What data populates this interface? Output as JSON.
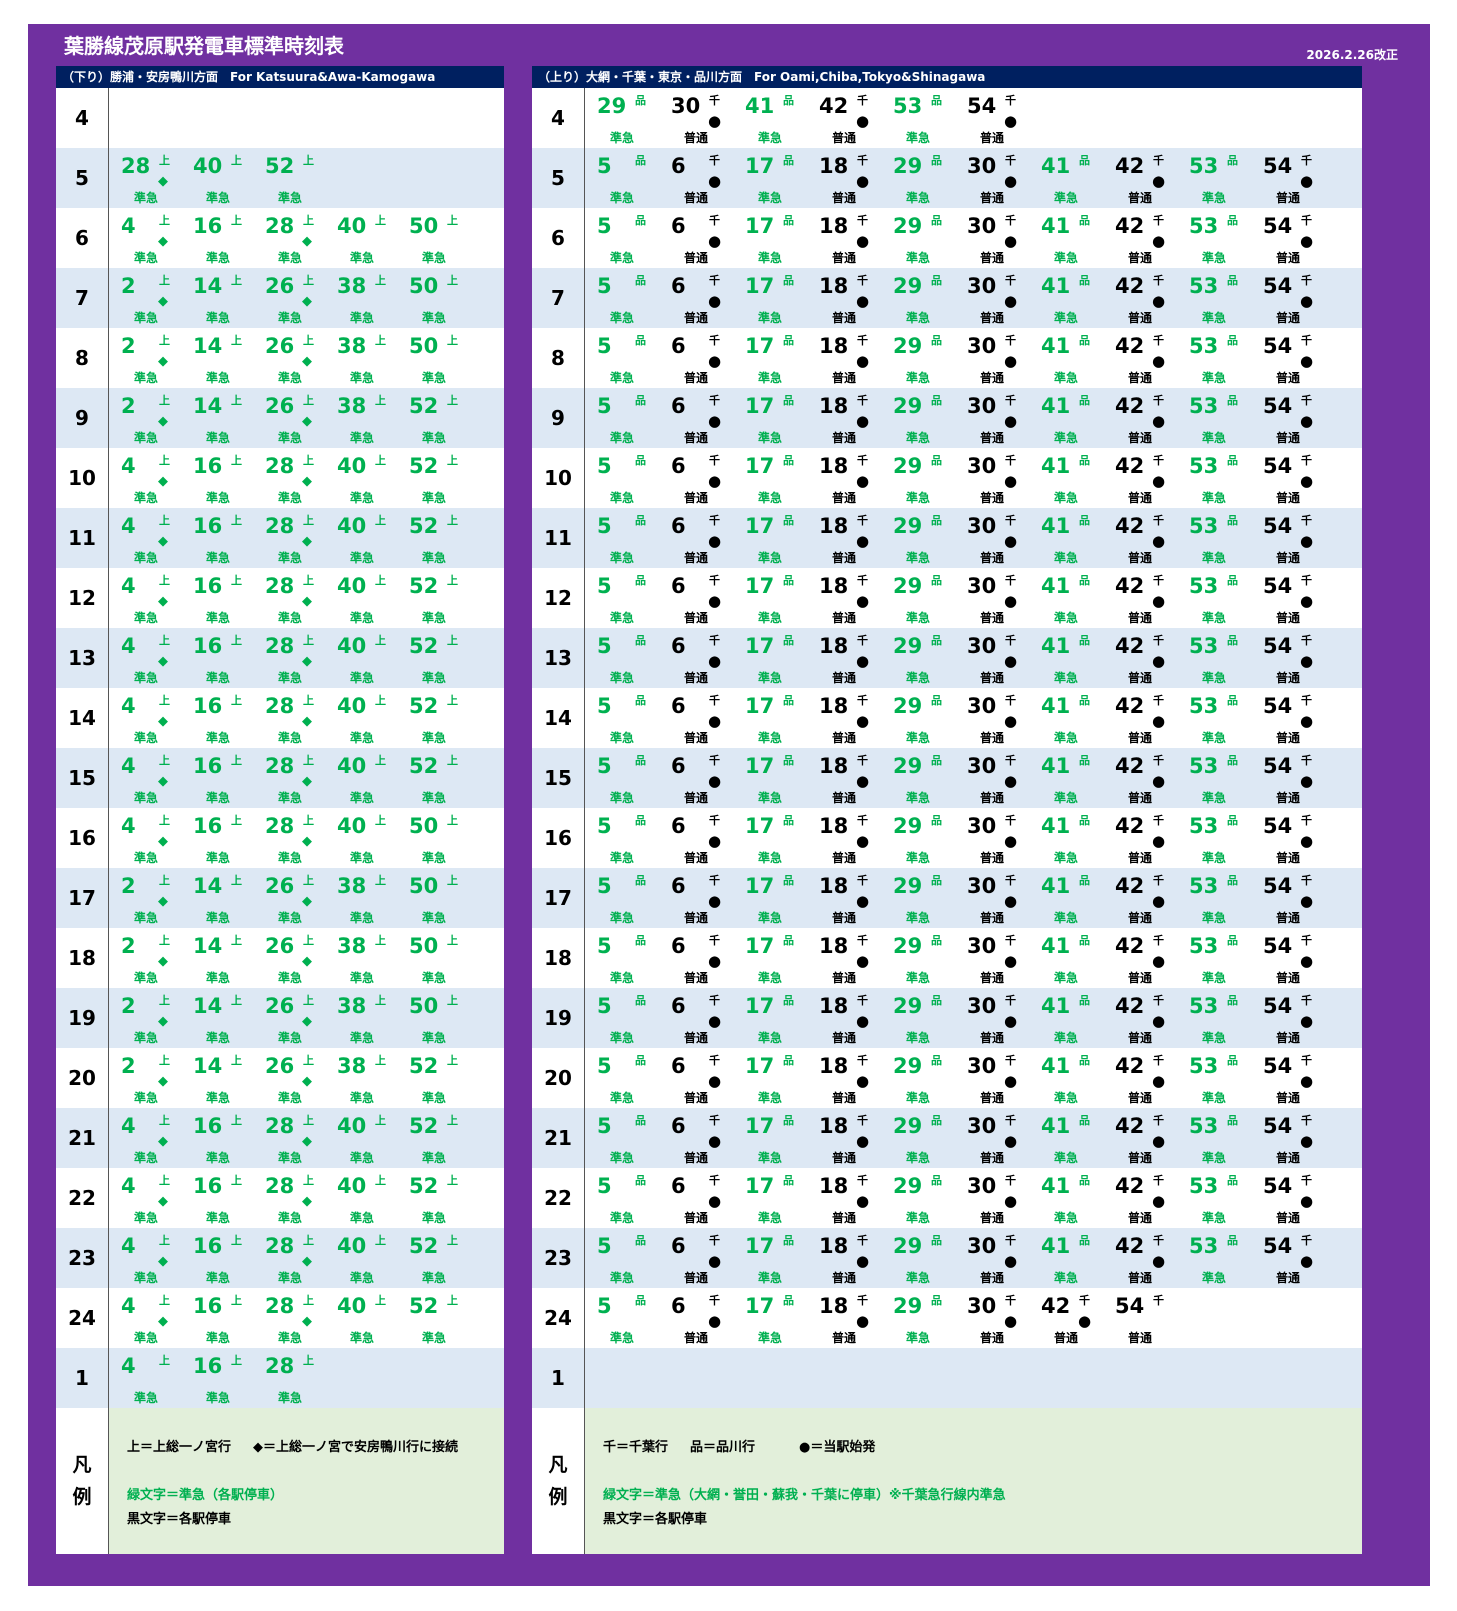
{
  "title": "葉勝線茂原駅発電車標準時刻表",
  "revision": "2026.2.26改正",
  "kind_labels": {
    "g": "準急",
    "b": "普通"
  },
  "dest_labels": {
    "上": "上",
    "品": "品",
    "千": "千"
  },
  "mark_labels": {
    "dm": "◆",
    "cr": "●"
  },
  "down": {
    "header": "（下り）勝浦・安房鴨川方面　For Katsuura&Awa-Kamogawa",
    "hours": [
      {
        "hour": "4",
        "trains": []
      },
      {
        "hour": "5",
        "trains": [
          {
            "m": "28",
            "k": "g",
            "d": "上",
            "mk": "dm"
          },
          {
            "m": "40",
            "k": "g",
            "d": "上"
          },
          {
            "m": "52",
            "k": "g",
            "d": "上"
          }
        ]
      },
      {
        "hour": "6",
        "trains": [
          {
            "m": "4",
            "k": "g",
            "d": "上",
            "mk": "dm"
          },
          {
            "m": "16",
            "k": "g",
            "d": "上"
          },
          {
            "m": "28",
            "k": "g",
            "d": "上",
            "mk": "dm"
          },
          {
            "m": "40",
            "k": "g",
            "d": "上"
          },
          {
            "m": "50",
            "k": "g",
            "d": "上"
          }
        ]
      },
      {
        "hour": "7",
        "trains": [
          {
            "m": "2",
            "k": "g",
            "d": "上",
            "mk": "dm"
          },
          {
            "m": "14",
            "k": "g",
            "d": "上"
          },
          {
            "m": "26",
            "k": "g",
            "d": "上",
            "mk": "dm"
          },
          {
            "m": "38",
            "k": "g",
            "d": "上"
          },
          {
            "m": "50",
            "k": "g",
            "d": "上"
          }
        ]
      },
      {
        "hour": "8",
        "trains": [
          {
            "m": "2",
            "k": "g",
            "d": "上",
            "mk": "dm"
          },
          {
            "m": "14",
            "k": "g",
            "d": "上"
          },
          {
            "m": "26",
            "k": "g",
            "d": "上",
            "mk": "dm"
          },
          {
            "m": "38",
            "k": "g",
            "d": "上"
          },
          {
            "m": "50",
            "k": "g",
            "d": "上"
          }
        ]
      },
      {
        "hour": "9",
        "trains": [
          {
            "m": "2",
            "k": "g",
            "d": "上",
            "mk": "dm"
          },
          {
            "m": "14",
            "k": "g",
            "d": "上"
          },
          {
            "m": "26",
            "k": "g",
            "d": "上",
            "mk": "dm"
          },
          {
            "m": "38",
            "k": "g",
            "d": "上"
          },
          {
            "m": "52",
            "k": "g",
            "d": "上"
          }
        ]
      },
      {
        "hour": "10",
        "trains": [
          {
            "m": "4",
            "k": "g",
            "d": "上",
            "mk": "dm"
          },
          {
            "m": "16",
            "k": "g",
            "d": "上"
          },
          {
            "m": "28",
            "k": "g",
            "d": "上",
            "mk": "dm"
          },
          {
            "m": "40",
            "k": "g",
            "d": "上"
          },
          {
            "m": "52",
            "k": "g",
            "d": "上"
          }
        ]
      },
      {
        "hour": "11",
        "trains": [
          {
            "m": "4",
            "k": "g",
            "d": "上",
            "mk": "dm"
          },
          {
            "m": "16",
            "k": "g",
            "d": "上"
          },
          {
            "m": "28",
            "k": "g",
            "d": "上",
            "mk": "dm"
          },
          {
            "m": "40",
            "k": "g",
            "d": "上"
          },
          {
            "m": "52",
            "k": "g",
            "d": "上"
          }
        ]
      },
      {
        "hour": "12",
        "trains": [
          {
            "m": "4",
            "k": "g",
            "d": "上",
            "mk": "dm"
          },
          {
            "m": "16",
            "k": "g",
            "d": "上"
          },
          {
            "m": "28",
            "k": "g",
            "d": "上",
            "mk": "dm"
          },
          {
            "m": "40",
            "k": "g",
            "d": "上"
          },
          {
            "m": "52",
            "k": "g",
            "d": "上"
          }
        ]
      },
      {
        "hour": "13",
        "trains": [
          {
            "m": "4",
            "k": "g",
            "d": "上",
            "mk": "dm"
          },
          {
            "m": "16",
            "k": "g",
            "d": "上"
          },
          {
            "m": "28",
            "k": "g",
            "d": "上",
            "mk": "dm"
          },
          {
            "m": "40",
            "k": "g",
            "d": "上"
          },
          {
            "m": "52",
            "k": "g",
            "d": "上"
          }
        ]
      },
      {
        "hour": "14",
        "trains": [
          {
            "m": "4",
            "k": "g",
            "d": "上",
            "mk": "dm"
          },
          {
            "m": "16",
            "k": "g",
            "d": "上"
          },
          {
            "m": "28",
            "k": "g",
            "d": "上",
            "mk": "dm"
          },
          {
            "m": "40",
            "k": "g",
            "d": "上"
          },
          {
            "m": "52",
            "k": "g",
            "d": "上"
          }
        ]
      },
      {
        "hour": "15",
        "trains": [
          {
            "m": "4",
            "k": "g",
            "d": "上",
            "mk": "dm"
          },
          {
            "m": "16",
            "k": "g",
            "d": "上"
          },
          {
            "m": "28",
            "k": "g",
            "d": "上",
            "mk": "dm"
          },
          {
            "m": "40",
            "k": "g",
            "d": "上"
          },
          {
            "m": "52",
            "k": "g",
            "d": "上"
          }
        ]
      },
      {
        "hour": "16",
        "trains": [
          {
            "m": "4",
            "k": "g",
            "d": "上",
            "mk": "dm"
          },
          {
            "m": "16",
            "k": "g",
            "d": "上"
          },
          {
            "m": "28",
            "k": "g",
            "d": "上",
            "mk": "dm"
          },
          {
            "m": "40",
            "k": "g",
            "d": "上"
          },
          {
            "m": "50",
            "k": "g",
            "d": "上"
          }
        ]
      },
      {
        "hour": "17",
        "trains": [
          {
            "m": "2",
            "k": "g",
            "d": "上",
            "mk": "dm"
          },
          {
            "m": "14",
            "k": "g",
            "d": "上"
          },
          {
            "m": "26",
            "k": "g",
            "d": "上",
            "mk": "dm"
          },
          {
            "m": "38",
            "k": "g",
            "d": "上"
          },
          {
            "m": "50",
            "k": "g",
            "d": "上"
          }
        ]
      },
      {
        "hour": "18",
        "trains": [
          {
            "m": "2",
            "k": "g",
            "d": "上",
            "mk": "dm"
          },
          {
            "m": "14",
            "k": "g",
            "d": "上"
          },
          {
            "m": "26",
            "k": "g",
            "d": "上",
            "mk": "dm"
          },
          {
            "m": "38",
            "k": "g",
            "d": "上"
          },
          {
            "m": "50",
            "k": "g",
            "d": "上"
          }
        ]
      },
      {
        "hour": "19",
        "trains": [
          {
            "m": "2",
            "k": "g",
            "d": "上",
            "mk": "dm"
          },
          {
            "m": "14",
            "k": "g",
            "d": "上"
          },
          {
            "m": "26",
            "k": "g",
            "d": "上",
            "mk": "dm"
          },
          {
            "m": "38",
            "k": "g",
            "d": "上"
          },
          {
            "m": "50",
            "k": "g",
            "d": "上"
          }
        ]
      },
      {
        "hour": "20",
        "trains": [
          {
            "m": "2",
            "k": "g",
            "d": "上",
            "mk": "dm"
          },
          {
            "m": "14",
            "k": "g",
            "d": "上"
          },
          {
            "m": "26",
            "k": "g",
            "d": "上",
            "mk": "dm"
          },
          {
            "m": "38",
            "k": "g",
            "d": "上"
          },
          {
            "m": "52",
            "k": "g",
            "d": "上"
          }
        ]
      },
      {
        "hour": "21",
        "trains": [
          {
            "m": "4",
            "k": "g",
            "d": "上",
            "mk": "dm"
          },
          {
            "m": "16",
            "k": "g",
            "d": "上"
          },
          {
            "m": "28",
            "k": "g",
            "d": "上",
            "mk": "dm"
          },
          {
            "m": "40",
            "k": "g",
            "d": "上"
          },
          {
            "m": "52",
            "k": "g",
            "d": "上"
          }
        ]
      },
      {
        "hour": "22",
        "trains": [
          {
            "m": "4",
            "k": "g",
            "d": "上",
            "mk": "dm"
          },
          {
            "m": "16",
            "k": "g",
            "d": "上"
          },
          {
            "m": "28",
            "k": "g",
            "d": "上",
            "mk": "dm"
          },
          {
            "m": "40",
            "k": "g",
            "d": "上"
          },
          {
            "m": "52",
            "k": "g",
            "d": "上"
          }
        ]
      },
      {
        "hour": "23",
        "trains": [
          {
            "m": "4",
            "k": "g",
            "d": "上",
            "mk": "dm"
          },
          {
            "m": "16",
            "k": "g",
            "d": "上"
          },
          {
            "m": "28",
            "k": "g",
            "d": "上",
            "mk": "dm"
          },
          {
            "m": "40",
            "k": "g",
            "d": "上"
          },
          {
            "m": "52",
            "k": "g",
            "d": "上"
          }
        ]
      },
      {
        "hour": "24",
        "trains": [
          {
            "m": "4",
            "k": "g",
            "d": "上",
            "mk": "dm"
          },
          {
            "m": "16",
            "k": "g",
            "d": "上"
          },
          {
            "m": "28",
            "k": "g",
            "d": "上",
            "mk": "dm"
          },
          {
            "m": "40",
            "k": "g",
            "d": "上"
          },
          {
            "m": "52",
            "k": "g",
            "d": "上"
          }
        ]
      },
      {
        "hour": "1",
        "trains": [
          {
            "m": "4",
            "k": "g",
            "d": "上"
          },
          {
            "m": "16",
            "k": "g",
            "d": "上"
          },
          {
            "m": "28",
            "k": "g",
            "d": "上"
          }
        ]
      }
    ],
    "legend": {
      "head_1": "凡",
      "head_2": "例",
      "line1_a": "上＝上総一ノ宮行",
      "line1_b": "◆＝上総一ノ宮で安房鴨川行に接続",
      "line2": "緑文字＝準急（各駅停車）",
      "line3": "黒文字＝各駅停車"
    }
  },
  "up": {
    "header": "（上り）大網・千葉・東京・品川方面　For Oami,Chiba,Tokyo&Shinagawa",
    "hours": [
      {
        "hour": "4",
        "trains": [
          {
            "m": "29",
            "k": "g",
            "d": "品"
          },
          {
            "m": "30",
            "k": "b",
            "d": "千",
            "mk": "cr"
          },
          {
            "m": "41",
            "k": "g",
            "d": "品"
          },
          {
            "m": "42",
            "k": "b",
            "d": "千",
            "mk": "cr"
          },
          {
            "m": "53",
            "k": "g",
            "d": "品"
          },
          {
            "m": "54",
            "k": "b",
            "d": "千",
            "mk": "cr"
          }
        ]
      },
      {
        "hour": "5",
        "std": true
      },
      {
        "hour": "6",
        "std": true
      },
      {
        "hour": "7",
        "std": true
      },
      {
        "hour": "8",
        "std": true
      },
      {
        "hour": "9",
        "std": true
      },
      {
        "hour": "10",
        "std": true
      },
      {
        "hour": "11",
        "std": true
      },
      {
        "hour": "12",
        "std": true
      },
      {
        "hour": "13",
        "std": true
      },
      {
        "hour": "14",
        "std": true
      },
      {
        "hour": "15",
        "std": true
      },
      {
        "hour": "16",
        "std": true
      },
      {
        "hour": "17",
        "std": true
      },
      {
        "hour": "18",
        "std": true
      },
      {
        "hour": "19",
        "std": true
      },
      {
        "hour": "20",
        "std": true
      },
      {
        "hour": "21",
        "std": true
      },
      {
        "hour": "22",
        "std": true
      },
      {
        "hour": "23",
        "std": true
      },
      {
        "hour": "24",
        "trains": [
          {
            "m": "5",
            "k": "g",
            "d": "品"
          },
          {
            "m": "6",
            "k": "b",
            "d": "千",
            "mk": "cr"
          },
          {
            "m": "17",
            "k": "g",
            "d": "品"
          },
          {
            "m": "18",
            "k": "b",
            "d": "千",
            "mk": "cr"
          },
          {
            "m": "29",
            "k": "g",
            "d": "品"
          },
          {
            "m": "30",
            "k": "b",
            "d": "千",
            "mk": "cr"
          },
          {
            "m": "42",
            "k": "b",
            "d": "千",
            "mk": "cr"
          },
          {
            "m": "54",
            "k": "b",
            "d": "千"
          }
        ]
      },
      {
        "hour": "1",
        "trains": []
      }
    ],
    "standard_trains": [
      {
        "m": "5",
        "k": "g",
        "d": "品"
      },
      {
        "m": "6",
        "k": "b",
        "d": "千",
        "mk": "cr"
      },
      {
        "m": "17",
        "k": "g",
        "d": "品"
      },
      {
        "m": "18",
        "k": "b",
        "d": "千",
        "mk": "cr"
      },
      {
        "m": "29",
        "k": "g",
        "d": "品"
      },
      {
        "m": "30",
        "k": "b",
        "d": "千",
        "mk": "cr"
      },
      {
        "m": "41",
        "k": "g",
        "d": "品"
      },
      {
        "m": "42",
        "k": "b",
        "d": "千",
        "mk": "cr"
      },
      {
        "m": "53",
        "k": "g",
        "d": "品"
      },
      {
        "m": "54",
        "k": "b",
        "d": "千",
        "mk": "cr"
      }
    ],
    "legend": {
      "head_1": "凡",
      "head_2": "例",
      "line1_a": "千＝千葉行",
      "line1_b": "品＝品川行",
      "line1_c": "●＝当駅始発",
      "line2": "緑文字＝準急（大網・誉田・蘇我・千葉に停車）※千葉急行線内準急",
      "line3": "黒文字＝各駅停車"
    }
  },
  "colors": {
    "frame": "#7030a0",
    "header_bar": "#002060",
    "green_text": "#00b050",
    "row_alt": "#dde8f4",
    "legend_bg": "#e2efda"
  }
}
